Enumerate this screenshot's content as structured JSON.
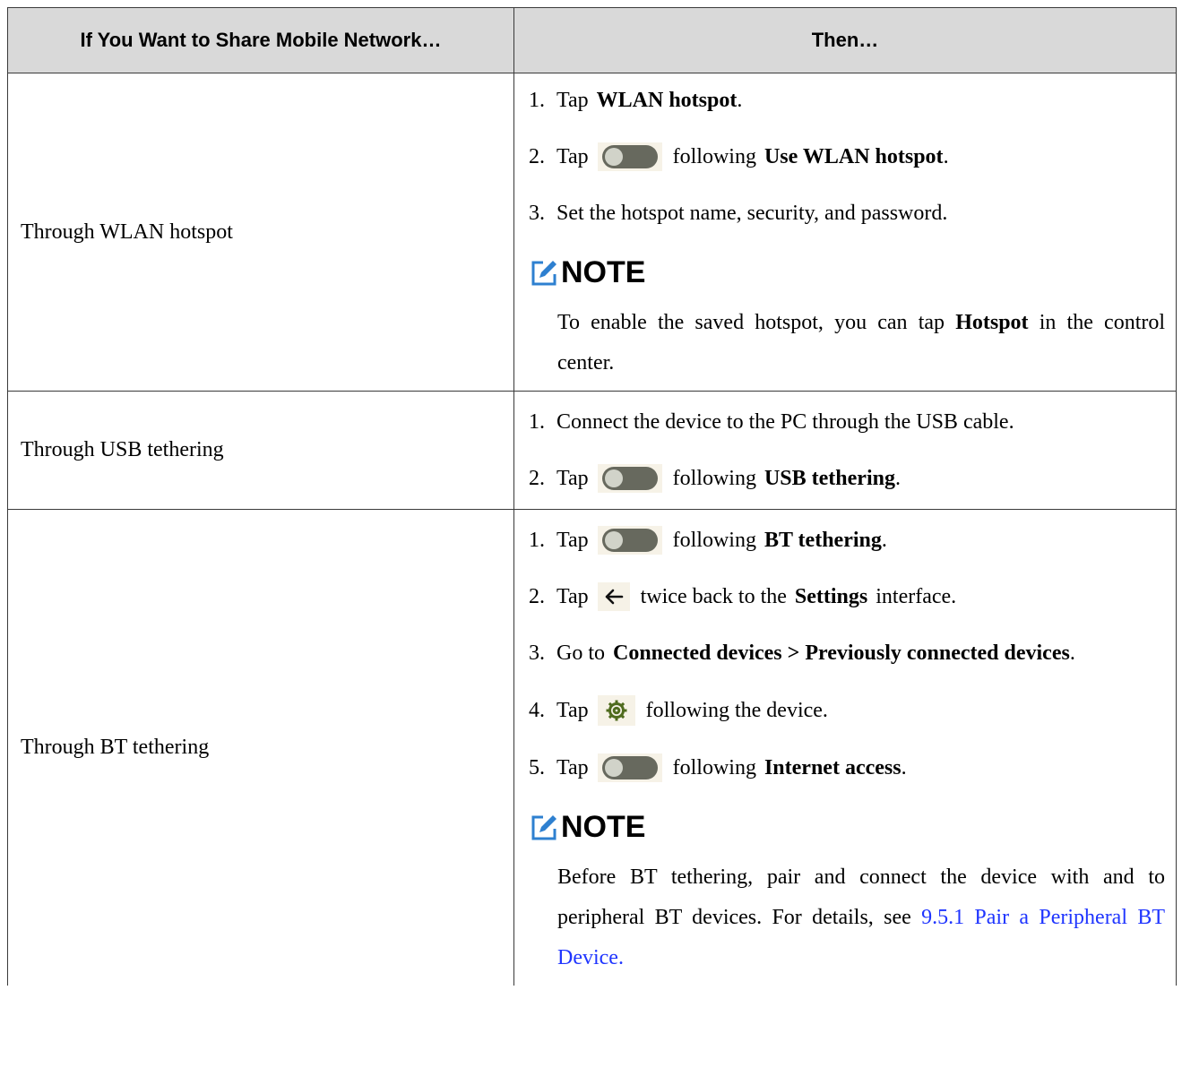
{
  "table": {
    "header": {
      "col1": "If You Want to Share Mobile Network…",
      "col2": "Then…"
    },
    "rows": [
      {
        "label": "Through WLAN hotspot",
        "steps": [
          {
            "num": "1.",
            "pre": "Tap",
            "bold": "WLAN hotspot",
            "post": "."
          },
          {
            "num": "2.",
            "pre": "Tap",
            "icon": "toggle-switch-icon",
            "mid": "following",
            "bold": "Use WLAN hotspot",
            "post": "."
          },
          {
            "num": "3.",
            "pre": "Set the hotspot name, security, and password."
          }
        ],
        "note": {
          "title": "NOTE",
          "pre": "To enable the saved hotspot, you can tap",
          "bold": "Hotspot",
          "post": "in the control center."
        }
      },
      {
        "label": "Through USB tethering",
        "steps": [
          {
            "num": "1.",
            "pre": "Connect the device to the PC through the USB cable."
          },
          {
            "num": "2.",
            "pre": "Tap",
            "icon": "toggle-switch-icon",
            "mid": "following",
            "bold": "USB tethering",
            "post": "."
          }
        ]
      },
      {
        "label": "Through BT tethering",
        "steps": [
          {
            "num": "1.",
            "pre": "Tap",
            "icon": "toggle-switch-icon",
            "mid": "following",
            "bold": "BT tethering",
            "post": "."
          },
          {
            "num": "2.",
            "pre": "Tap",
            "icon": "back-arrow-icon",
            "mid": "twice back to the",
            "bold": "Settings",
            "post": "interface."
          },
          {
            "num": "3.",
            "pre": "Go to",
            "bold": "Connected devices > Previously connected devices",
            "post": "."
          },
          {
            "num": "4.",
            "pre": "Tap",
            "icon": "gear-icon",
            "mid": "following the device."
          },
          {
            "num": "5.",
            "pre": "Tap",
            "icon": "toggle-switch-icon",
            "mid": "following",
            "bold": "Internet access",
            "post": "."
          }
        ],
        "note": {
          "title": "NOTE",
          "pre": "Before BT tethering, pair and connect the device with and to peripheral BT devices. For details, see",
          "link": "9.5.1 Pair a Peripheral BT Device."
        }
      }
    ]
  },
  "colors": {
    "header_bg": "#d9d9d9",
    "link": "#1f35ff",
    "icon_bg": "#f6f2e7",
    "toggle_track": "#67695e",
    "note_icon": "#2e80d0"
  }
}
